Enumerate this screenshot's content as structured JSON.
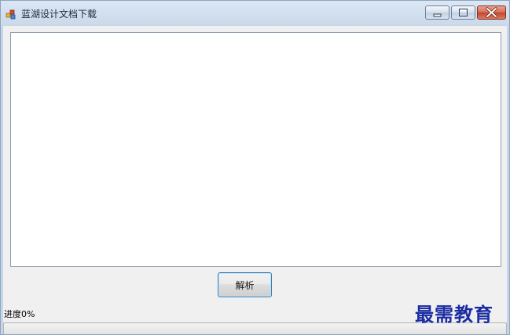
{
  "window": {
    "title": "蓝湖设计文档下载",
    "icon": "app-icon"
  },
  "caption_buttons": {
    "minimize_icon": "minimize-icon",
    "maximize_icon": "maximize-icon",
    "close_icon": "close-icon",
    "close_color": "#c3452b"
  },
  "main": {
    "text_value": "",
    "parse_label": "解析"
  },
  "progress": {
    "label": "进度0%",
    "fraction": 0
  },
  "watermark": {
    "text": "最需教育",
    "color": "#1b2ca3"
  }
}
